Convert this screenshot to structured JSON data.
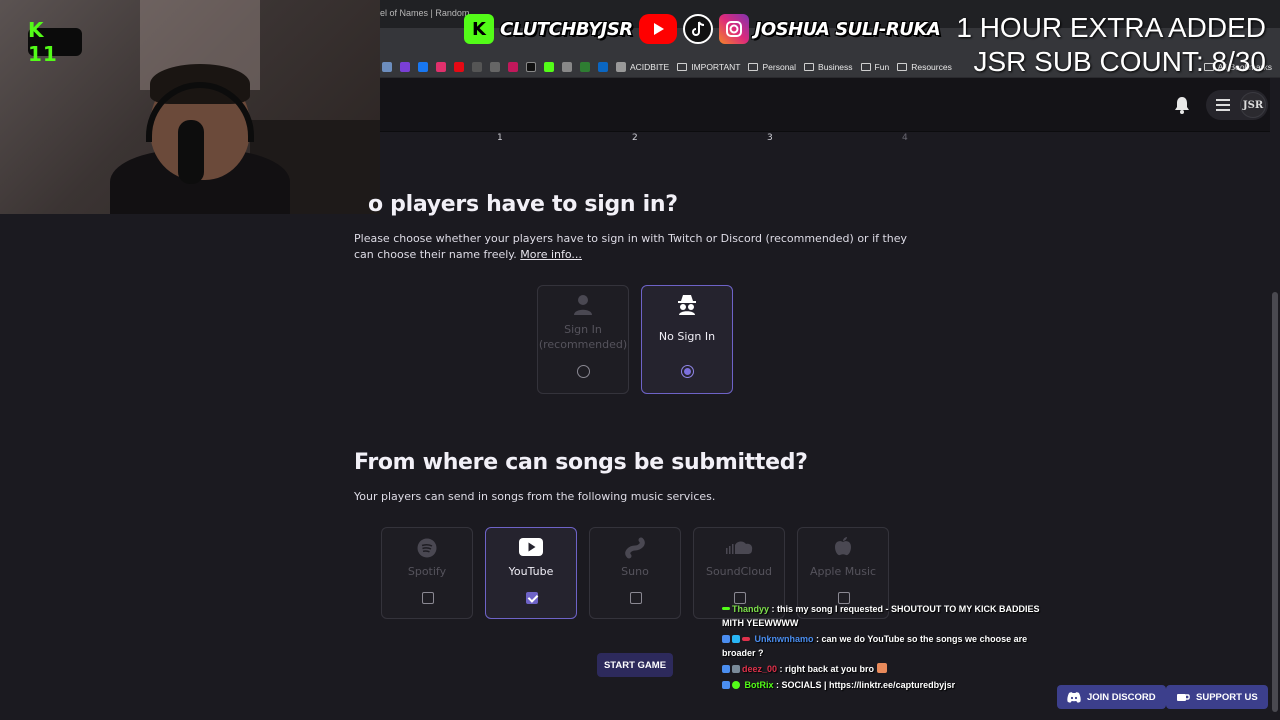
{
  "browser": {
    "tab_title": "el of Names | Random",
    "bookmarks": {
      "acidbite": "ACIDBITE",
      "folders": [
        "IMPORTANT",
        "Personal",
        "Business",
        "Fun",
        "Resources"
      ],
      "all_bookmarks": "All Bookmarks"
    }
  },
  "overlay": {
    "kick_badge": "K 11",
    "handle_kick": "CLUTCHBYJSR",
    "handle_socials": "JOSHUA SULI-RUKA",
    "extra_added": "1 HOUR EXTRA ADDED",
    "sub_count": "JSR SUB COUNT: 8/30"
  },
  "header": {
    "avatar_text": "JSR"
  },
  "stepper": [
    "1",
    "2",
    "3",
    "4"
  ],
  "signin_section": {
    "title": "o players have to sign in?",
    "description": "Please choose whether your players have to sign in with Twitch or Discord (recommended) or if they can choose their name freely.",
    "more_info": "More info...",
    "options": [
      {
        "label": "Sign In (recommended)",
        "selected": false
      },
      {
        "label": "No Sign In",
        "selected": true
      }
    ]
  },
  "songs_section": {
    "title": "From where can songs be submitted?",
    "description": "Your players can send in songs from the following music services.",
    "services": [
      {
        "label": "Spotify",
        "checked": false,
        "icon": "spotify-icon"
      },
      {
        "label": "YouTube",
        "checked": true,
        "icon": "youtube-icon"
      },
      {
        "label": "Suno",
        "checked": false,
        "icon": "suno-icon"
      },
      {
        "label": "SoundCloud",
        "checked": false,
        "icon": "soundcloud-icon"
      },
      {
        "label": "Apple Music",
        "checked": false,
        "icon": "apple-icon"
      }
    ]
  },
  "start_button": "START GAME",
  "chat": [
    {
      "user": "Thandyy",
      "user_color": "#7ee04c",
      "message": ": this my song I requested - SHOUTOUT TO MY KICK BADDIES MITH YEEWWWW"
    },
    {
      "user": "Unknwnhamo",
      "user_color": "#4b8ef0",
      "message": ": can we do YouTube so the songs we choose are broader ?"
    },
    {
      "user": "deez_00",
      "user_color": "#e0314b",
      "message": ": right back at you bro"
    },
    {
      "user": "BotRix",
      "user_color": "#53fc18",
      "message": ": SOCIALS | https://linktr.ee/capturedbyjsr"
    }
  ],
  "footer_buttons": {
    "discord": "JOIN DISCORD",
    "support": "SUPPORT US"
  },
  "colors": {
    "accent": "#6e63c7",
    "kick_green": "#53fc18",
    "background": "#1b1a20"
  }
}
